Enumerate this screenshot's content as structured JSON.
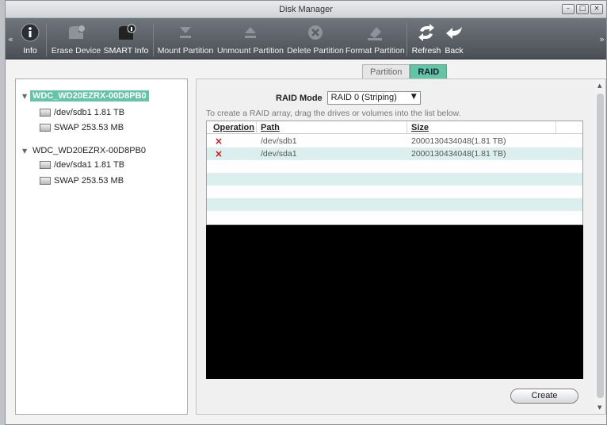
{
  "window": {
    "title": "Disk Manager",
    "controls": {
      "minimize": "–",
      "maximize": "□",
      "close": "×"
    }
  },
  "toolbar": {
    "scroll_left": "«",
    "scroll_right": "»",
    "items": [
      {
        "label": "Info",
        "icon": "info-icon",
        "enabled": true
      },
      {
        "label": "Erase Device",
        "icon": "erase-device-icon",
        "enabled": false
      },
      {
        "label": "SMART Info",
        "icon": "smart-info-icon",
        "enabled": true
      },
      {
        "label": "Mount Partition",
        "icon": "mount-icon",
        "enabled": false
      },
      {
        "label": "Unmount Partition",
        "icon": "unmount-icon",
        "enabled": false
      },
      {
        "label": "Delete Partition",
        "icon": "delete-partition-icon",
        "enabled": false
      },
      {
        "label": "Format Partition",
        "icon": "format-icon",
        "enabled": false
      },
      {
        "label": "Refresh",
        "icon": "refresh-icon",
        "enabled": true
      },
      {
        "label": "Back",
        "icon": "back-icon",
        "enabled": true
      }
    ]
  },
  "tabs": [
    {
      "label": "Partition",
      "active": false
    },
    {
      "label": "RAID",
      "active": true
    }
  ],
  "tree": {
    "disks": [
      {
        "name": "WDC_WD20EZRX-00D8PB0",
        "selected": true,
        "partitions": [
          "/dev/sdb1 1.81 TB",
          "SWAP 253.53 MB"
        ]
      },
      {
        "name": "WDC_WD20EZRX-00D8PB0",
        "selected": false,
        "partitions": [
          "/dev/sda1 1.81 TB",
          "SWAP 253.53 MB"
        ]
      }
    ]
  },
  "raid": {
    "mode_label": "RAID Mode",
    "mode_value": "RAID 0 (Striping)",
    "hint": "To create a RAID array, drag the drives or volumes into the list below.",
    "columns": {
      "operation": "Operation",
      "path": "Path",
      "size": "Size"
    },
    "rows": [
      {
        "operation": "×",
        "path": "/dev/sdb1",
        "size": "2000130434048(1.81 TB)"
      },
      {
        "operation": "×",
        "path": "/dev/sda1",
        "size": "2000130434048(1.81 TB)"
      }
    ],
    "create_label": "Create"
  },
  "colors": {
    "accent": "#64c5a6",
    "row_alt": "#dcefef",
    "toolbar_bg": "#5c6168",
    "delete_red": "#d01010"
  }
}
